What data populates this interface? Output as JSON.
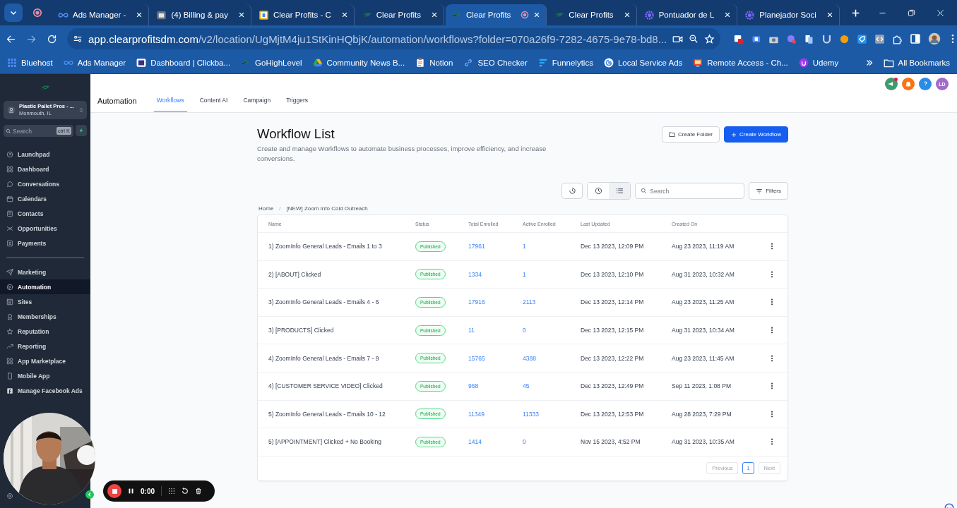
{
  "browser": {
    "tabs": [
      {
        "title": "Ads Manager -",
        "selected": false,
        "recording": false
      },
      {
        "title": "(4) Billing & pay",
        "selected": false,
        "recording": false
      },
      {
        "title": "Clear Profits - C",
        "selected": false,
        "recording": false
      },
      {
        "title": "Clear Profits",
        "selected": false,
        "recording": false
      },
      {
        "title": "Clear Profits",
        "selected": true,
        "recording": true
      },
      {
        "title": "Clear Profits",
        "selected": false,
        "recording": false
      },
      {
        "title": "Pontuador de L",
        "selected": false,
        "recording": false
      },
      {
        "title": "Planejador Soci",
        "selected": false,
        "recording": false
      }
    ],
    "url": {
      "host": "app.clearprofitsdm.com",
      "path": "/v2/location/UgMjtM4ju1StKinHQbjK/automation/workflows?folder=070a26f9-7282-4675-9e78-bd8..."
    },
    "bookmarks": [
      "Bluehost",
      "Ads Manager",
      "Dashboard | Clickba...",
      "GoHighLevel",
      "Community News B...",
      "Notion",
      "SEO Checker",
      "Funnelytics",
      "Local Service Ads",
      "Remote Access - Ch...",
      "Udemy"
    ],
    "all_bookmarks": "All Bookmarks"
  },
  "sidebar": {
    "account": {
      "name": "Plastic Pallet Pros - ...",
      "location": "Monmouth, IL"
    },
    "search": {
      "placeholder": "Search",
      "shortcut": "ctrl K"
    },
    "sections": [
      [
        {
          "label": "Launchpad",
          "selected": false
        },
        {
          "label": "Dashboard",
          "selected": false
        },
        {
          "label": "Conversations",
          "selected": false
        },
        {
          "label": "Calendars",
          "selected": false
        },
        {
          "label": "Contacts",
          "selected": false
        },
        {
          "label": "Opportunities",
          "selected": false
        },
        {
          "label": "Payments",
          "selected": false
        }
      ],
      [
        {
          "label": "Marketing",
          "selected": false
        },
        {
          "label": "Automation",
          "selected": true
        },
        {
          "label": "Sites",
          "selected": false
        },
        {
          "label": "Memberships",
          "selected": false
        },
        {
          "label": "Reputation",
          "selected": false
        },
        {
          "label": "Reporting",
          "selected": false
        },
        {
          "label": "App Marketplace",
          "selected": false
        },
        {
          "label": "Mobile App",
          "selected": false
        },
        {
          "label": "Manage Facebook Ads",
          "selected": false
        }
      ]
    ]
  },
  "topbar": {
    "title": "Automation",
    "tabs": [
      {
        "label": "Workflows",
        "selected": true
      },
      {
        "label": "Content AI",
        "selected": false
      },
      {
        "label": "Campaign",
        "selected": false
      },
      {
        "label": "Triggers",
        "selected": false
      }
    ],
    "user_initials": "LD"
  },
  "page": {
    "title": "Workflow List",
    "description": "Create and manage Workflows to automate business processes, improve efficiency, and increase conversions.",
    "create_folder": "Create Folder",
    "create_workflow": "Create Workflow",
    "search_placeholder": "Search",
    "filters": "Filters",
    "breadcrumb": {
      "items": [
        "Home",
        "[NEW] Zoom Info Cold Outreach"
      ],
      "separator": "/"
    },
    "table": {
      "columns": [
        "Name",
        "Status",
        "Total Enrolled",
        "Active Enrolled",
        "Last Updated",
        "Created On"
      ],
      "rows": [
        {
          "name": "1) ZoomInfo General Leads - Emails 1 to 3",
          "status": "Published",
          "total": "17961",
          "active": "1",
          "updated": "Dec 13 2023, 12:09 PM",
          "created": "Aug 23 2023, 11:19 AM"
        },
        {
          "name": "2) [ABOUT] Clicked",
          "status": "Published",
          "total": "1334",
          "active": "1",
          "updated": "Dec 13 2023, 12:10 PM",
          "created": "Aug 31 2023, 10:32 AM"
        },
        {
          "name": "3) ZoomInfo General Leads - Emails 4 - 6",
          "status": "Published",
          "total": "17916",
          "active": "2113",
          "updated": "Dec 13 2023, 12:14 PM",
          "created": "Aug 23 2023, 11:25 AM"
        },
        {
          "name": "3) [PRODUCTS] Clicked",
          "status": "Published",
          "total": "11",
          "active": "0",
          "updated": "Dec 13 2023, 12:15 PM",
          "created": "Aug 31 2023, 10:34 AM"
        },
        {
          "name": "4) ZoomInfo General Leads - Emails 7 - 9",
          "status": "Published",
          "total": "15765",
          "active": "4388",
          "updated": "Dec 13 2023, 12:22 PM",
          "created": "Aug 23 2023, 11:45 AM"
        },
        {
          "name": "4) [CUSTOMER SERVICE VIDEO] Clicked",
          "status": "Published",
          "total": "968",
          "active": "45",
          "updated": "Dec 13 2023, 12:49 PM",
          "created": "Sep 11 2023, 1:08 PM"
        },
        {
          "name": "5) ZoomInfo General Leads - Emails 10 - 12",
          "status": "Published",
          "total": "11349",
          "active": "11333",
          "updated": "Dec 13 2023, 12:53 PM",
          "created": "Aug 28 2023, 7:29 PM"
        },
        {
          "name": "5) [APPOINTMENT] Clicked + No Booking",
          "status": "Published",
          "total": "1414",
          "active": "0",
          "updated": "Nov 15 2023, 4:52 PM",
          "created": "Aug 31 2023, 10:35 AM"
        }
      ]
    },
    "pagination": {
      "previous": "Previous",
      "pages": [
        {
          "label": "1",
          "selected": true
        }
      ],
      "next": "Next"
    }
  },
  "recorder": {
    "time": "0:00"
  }
}
